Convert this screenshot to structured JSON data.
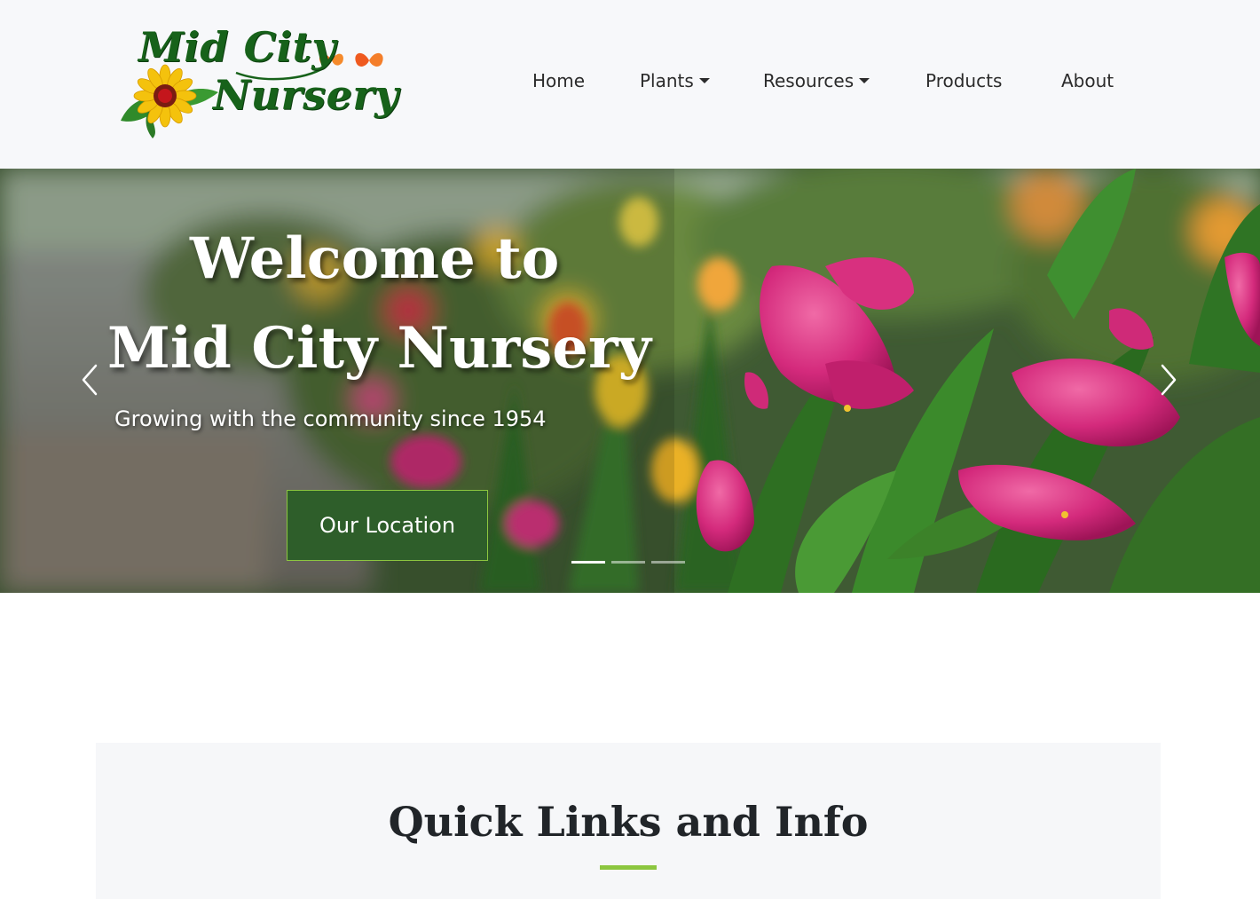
{
  "header": {
    "logo": {
      "line1": "Mid City",
      "line2": "Nursery",
      "icon": "sunflower-butterfly-icon"
    },
    "nav": [
      {
        "label": "Home",
        "has_dropdown": false
      },
      {
        "label": "Plants",
        "has_dropdown": true
      },
      {
        "label": "Resources",
        "has_dropdown": true
      },
      {
        "label": "Products",
        "has_dropdown": false
      },
      {
        "label": "About",
        "has_dropdown": false
      }
    ]
  },
  "hero": {
    "title_line1": "Welcome to",
    "title_line2": "Mid City Nursery",
    "subtitle": "Growing with the community since 1954",
    "cta_label": "Our Location",
    "prev_icon": "chevron-left-icon",
    "next_icon": "chevron-right-icon",
    "slide_count": 3,
    "active_slide": 0
  },
  "quick_links": {
    "title": "Quick Links and Info"
  },
  "colors": {
    "brand_green": "#2e5e2a",
    "accent_lime": "#8cc63f",
    "logo_green": "#17621a",
    "header_bg": "#f7f8fa",
    "calla_pink": "#d9287a"
  }
}
